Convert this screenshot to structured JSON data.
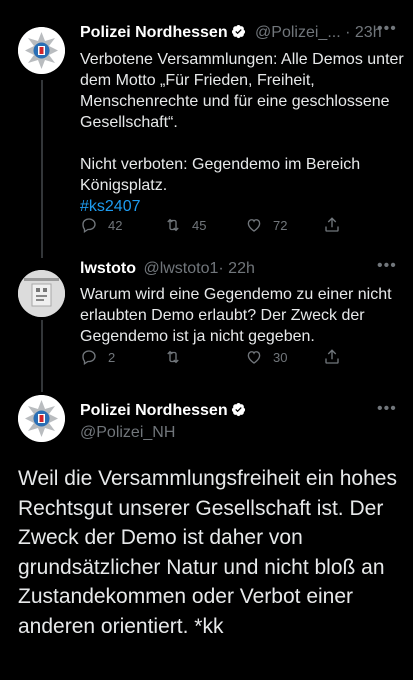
{
  "tweet1": {
    "display_name": "Polizei Nordhessen",
    "handle": "@Polizei_...",
    "separator": "·",
    "time": "23h",
    "text": "Verbotene Versammlungen: Alle Demos unter dem Motto „Für Frieden, Freiheit, Menschenrechte und für eine geschlossene Gesellschaft“.\n\nNicht verboten: Gegendemo im Bereich Königsplatz.",
    "hashtag": "#ks2407",
    "replies": "42",
    "retweets": "45",
    "likes": "72"
  },
  "tweet2": {
    "display_name": "lwstoto",
    "handle": "@lwstoto1",
    "separator": "·",
    "time": "22h",
    "text": "Warum wird eine Gegendemo zu einer nicht erlaubten Demo erlaubt? Der Zweck der Gegendemo ist ja nicht gegeben.",
    "replies": "2",
    "retweets": "",
    "likes": "30"
  },
  "tweet3": {
    "display_name": "Polizei Nordhessen",
    "handle": "@Polizei_NH",
    "text": "Weil die Versammlungsfreiheit ein hohes Rechtsgut unserer Gesellschaft ist. Der Zweck der Demo ist daher von grundsätzlicher Natur und nicht bloß an Zustandekommen oder Verbot einer anderen orientiert. *kk"
  },
  "colors": {
    "background": "#000000",
    "text": "#e7e9ea",
    "muted": "#71767b",
    "link": "#1d9bf0",
    "verified": "#1d9bf0"
  },
  "icons": [
    "reply-icon",
    "retweet-icon",
    "like-icon",
    "share-icon",
    "verified-icon",
    "more-icon"
  ]
}
